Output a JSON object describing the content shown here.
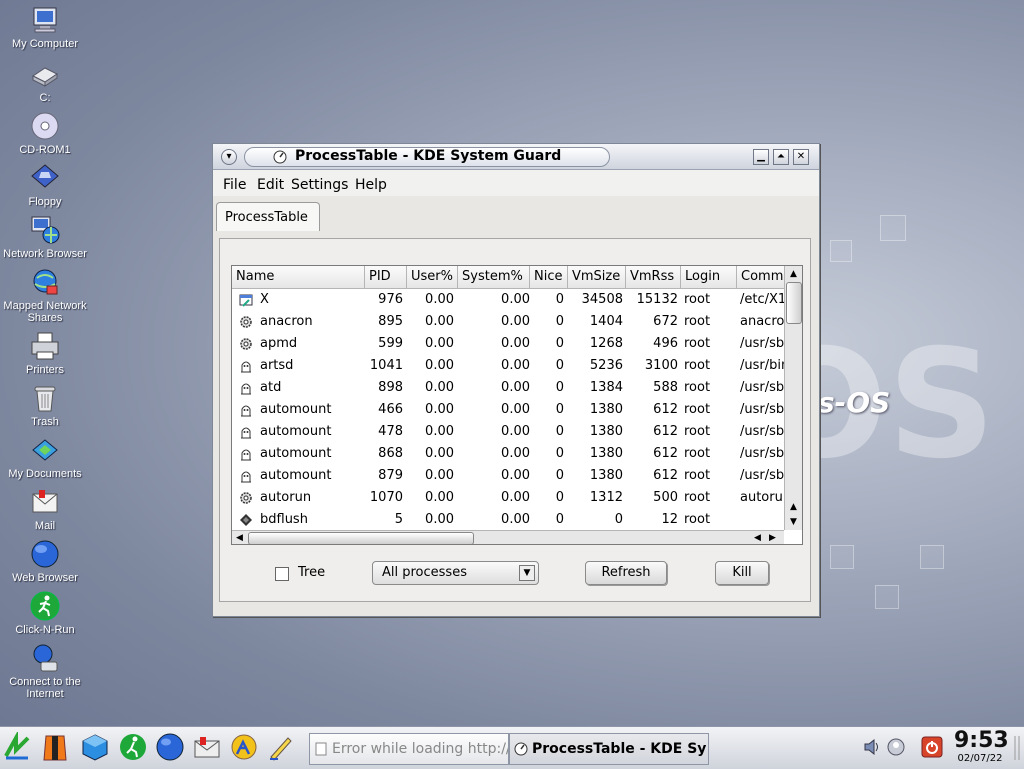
{
  "desktop": {
    "icons": [
      {
        "label": "My Computer"
      },
      {
        "label": "C:"
      },
      {
        "label": "CD-ROM1"
      },
      {
        "label": "Floppy"
      },
      {
        "label": "Network Browser"
      },
      {
        "label": "Mapped Network Shares"
      },
      {
        "label": "Printers"
      },
      {
        "label": "Trash"
      },
      {
        "label": "My Documents"
      },
      {
        "label": "Mail"
      },
      {
        "label": "Web Browser"
      },
      {
        "label": "Click-N-Run"
      },
      {
        "label": "Connect to the Internet"
      }
    ],
    "logo_text": "OS",
    "logo_small": "s-OS"
  },
  "window": {
    "title": "ProcessTable - KDE System Guard",
    "menu": [
      "File",
      "Edit",
      "Settings",
      "Help"
    ],
    "tab": "ProcessTable",
    "columns": [
      "Name",
      "PID",
      "User%",
      "System%",
      "Nice",
      "VmSize",
      "VmRss",
      "Login",
      "Comm"
    ],
    "rows": [
      {
        "name": "X",
        "pid": "976",
        "user": "0.00",
        "system": "0.00",
        "nice": "0",
        "vmsize": "34508",
        "vmrss": "15132",
        "login": "root",
        "cmd": "/etc/X1",
        "icon": "window-icon"
      },
      {
        "name": "anacron",
        "pid": "895",
        "user": "0.00",
        "system": "0.00",
        "nice": "0",
        "vmsize": "1404",
        "vmrss": "672",
        "login": "root",
        "cmd": "anacron",
        "icon": "gear-icon"
      },
      {
        "name": "apmd",
        "pid": "599",
        "user": "0.00",
        "system": "0.00",
        "nice": "0",
        "vmsize": "1268",
        "vmrss": "496",
        "login": "root",
        "cmd": "/usr/sbi",
        "icon": "gear-icon"
      },
      {
        "name": "artsd",
        "pid": "1041",
        "user": "0.00",
        "system": "0.00",
        "nice": "0",
        "vmsize": "5236",
        "vmrss": "3100",
        "login": "root",
        "cmd": "/usr/bin",
        "icon": "daemon-icon"
      },
      {
        "name": "atd",
        "pid": "898",
        "user": "0.00",
        "system": "0.00",
        "nice": "0",
        "vmsize": "1384",
        "vmrss": "588",
        "login": "root",
        "cmd": "/usr/sbi",
        "icon": "daemon-icon"
      },
      {
        "name": "automount",
        "pid": "466",
        "user": "0.00",
        "system": "0.00",
        "nice": "0",
        "vmsize": "1380",
        "vmrss": "612",
        "login": "root",
        "cmd": "/usr/sbi",
        "icon": "daemon-icon"
      },
      {
        "name": "automount",
        "pid": "478",
        "user": "0.00",
        "system": "0.00",
        "nice": "0",
        "vmsize": "1380",
        "vmrss": "612",
        "login": "root",
        "cmd": "/usr/sbi",
        "icon": "daemon-icon"
      },
      {
        "name": "automount",
        "pid": "868",
        "user": "0.00",
        "system": "0.00",
        "nice": "0",
        "vmsize": "1380",
        "vmrss": "612",
        "login": "root",
        "cmd": "/usr/sbi",
        "icon": "daemon-icon"
      },
      {
        "name": "automount",
        "pid": "879",
        "user": "0.00",
        "system": "0.00",
        "nice": "0",
        "vmsize": "1380",
        "vmrss": "612",
        "login": "root",
        "cmd": "/usr/sbi",
        "icon": "daemon-icon"
      },
      {
        "name": "autorun",
        "pid": "1070",
        "user": "0.00",
        "system": "0.00",
        "nice": "0",
        "vmsize": "1312",
        "vmrss": "500",
        "login": "root",
        "cmd": "autorun",
        "icon": "gear-icon"
      },
      {
        "name": "bdflush",
        "pid": "5",
        "user": "0.00",
        "system": "0.00",
        "nice": "0",
        "vmsize": "0",
        "vmrss": "12",
        "login": "root",
        "cmd": "",
        "icon": "kernel-icon"
      }
    ],
    "tree_label": "Tree",
    "filter_value": "All processes",
    "refresh_label": "Refresh",
    "kill_label": "Kill"
  },
  "taskbar": {
    "tasks": [
      "Error while loading http://r",
      "ProcessTable - KDE Sy"
    ],
    "clock_time": "9:53",
    "clock_date": "02/07/22"
  }
}
